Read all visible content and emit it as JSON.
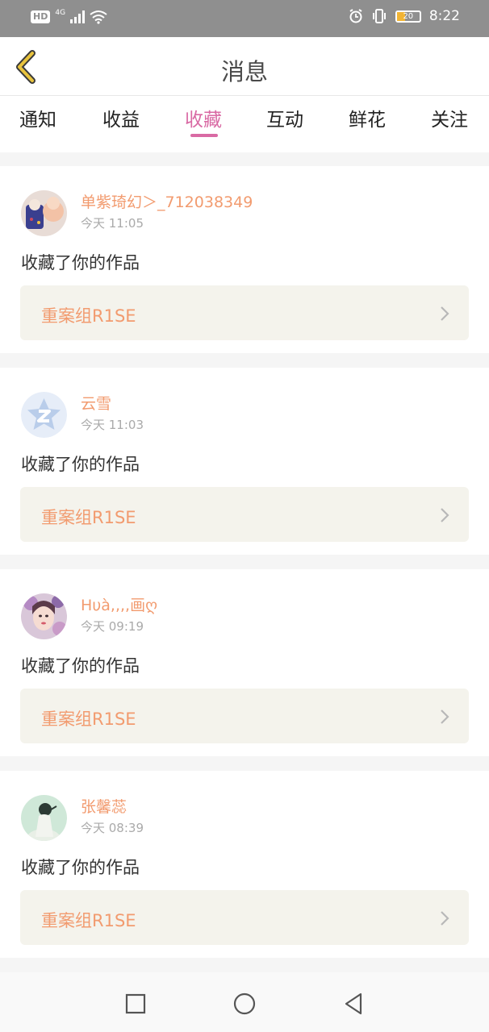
{
  "status_bar": {
    "left_badge": "HD",
    "network": "4G",
    "battery_level": "20",
    "time": "8:22",
    "icons": [
      "wifi-icon",
      "signal-icon",
      "alarm-icon",
      "vibrate-icon",
      "battery-icon"
    ]
  },
  "header": {
    "title": "消息",
    "back_icon": "back-chevron-icon"
  },
  "tabs": [
    {
      "label": "通知",
      "active": false
    },
    {
      "label": "收益",
      "active": false
    },
    {
      "label": "收藏",
      "active": true
    },
    {
      "label": "互动",
      "active": false
    },
    {
      "label": "鲜花",
      "active": false
    },
    {
      "label": "关注",
      "active": false
    }
  ],
  "messages": [
    {
      "username": "单紫琦幻＞_712038349",
      "time": "今天 11:05",
      "action": "收藏了你的作品",
      "work_title": "重案组R1SE"
    },
    {
      "username": "云雪",
      "time": "今天 11:03",
      "action": "收藏了你的作品",
      "work_title": "重案组R1SE"
    },
    {
      "username": "Hυà,,,,画ღ",
      "time": "今天 09:19",
      "action": "收藏了你的作品",
      "work_title": "重案组R1SE"
    },
    {
      "username": "张馨蕊",
      "time": "今天 08:39",
      "action": "收藏了你的作品",
      "work_title": "重案组R1SE"
    }
  ],
  "colors": {
    "accent_pink": "#d96aa4",
    "username_orange": "#f29b6f",
    "back_yellow": "#e8c33d"
  },
  "nav_bar": [
    "square-icon",
    "circle-icon",
    "triangle-back-icon"
  ]
}
